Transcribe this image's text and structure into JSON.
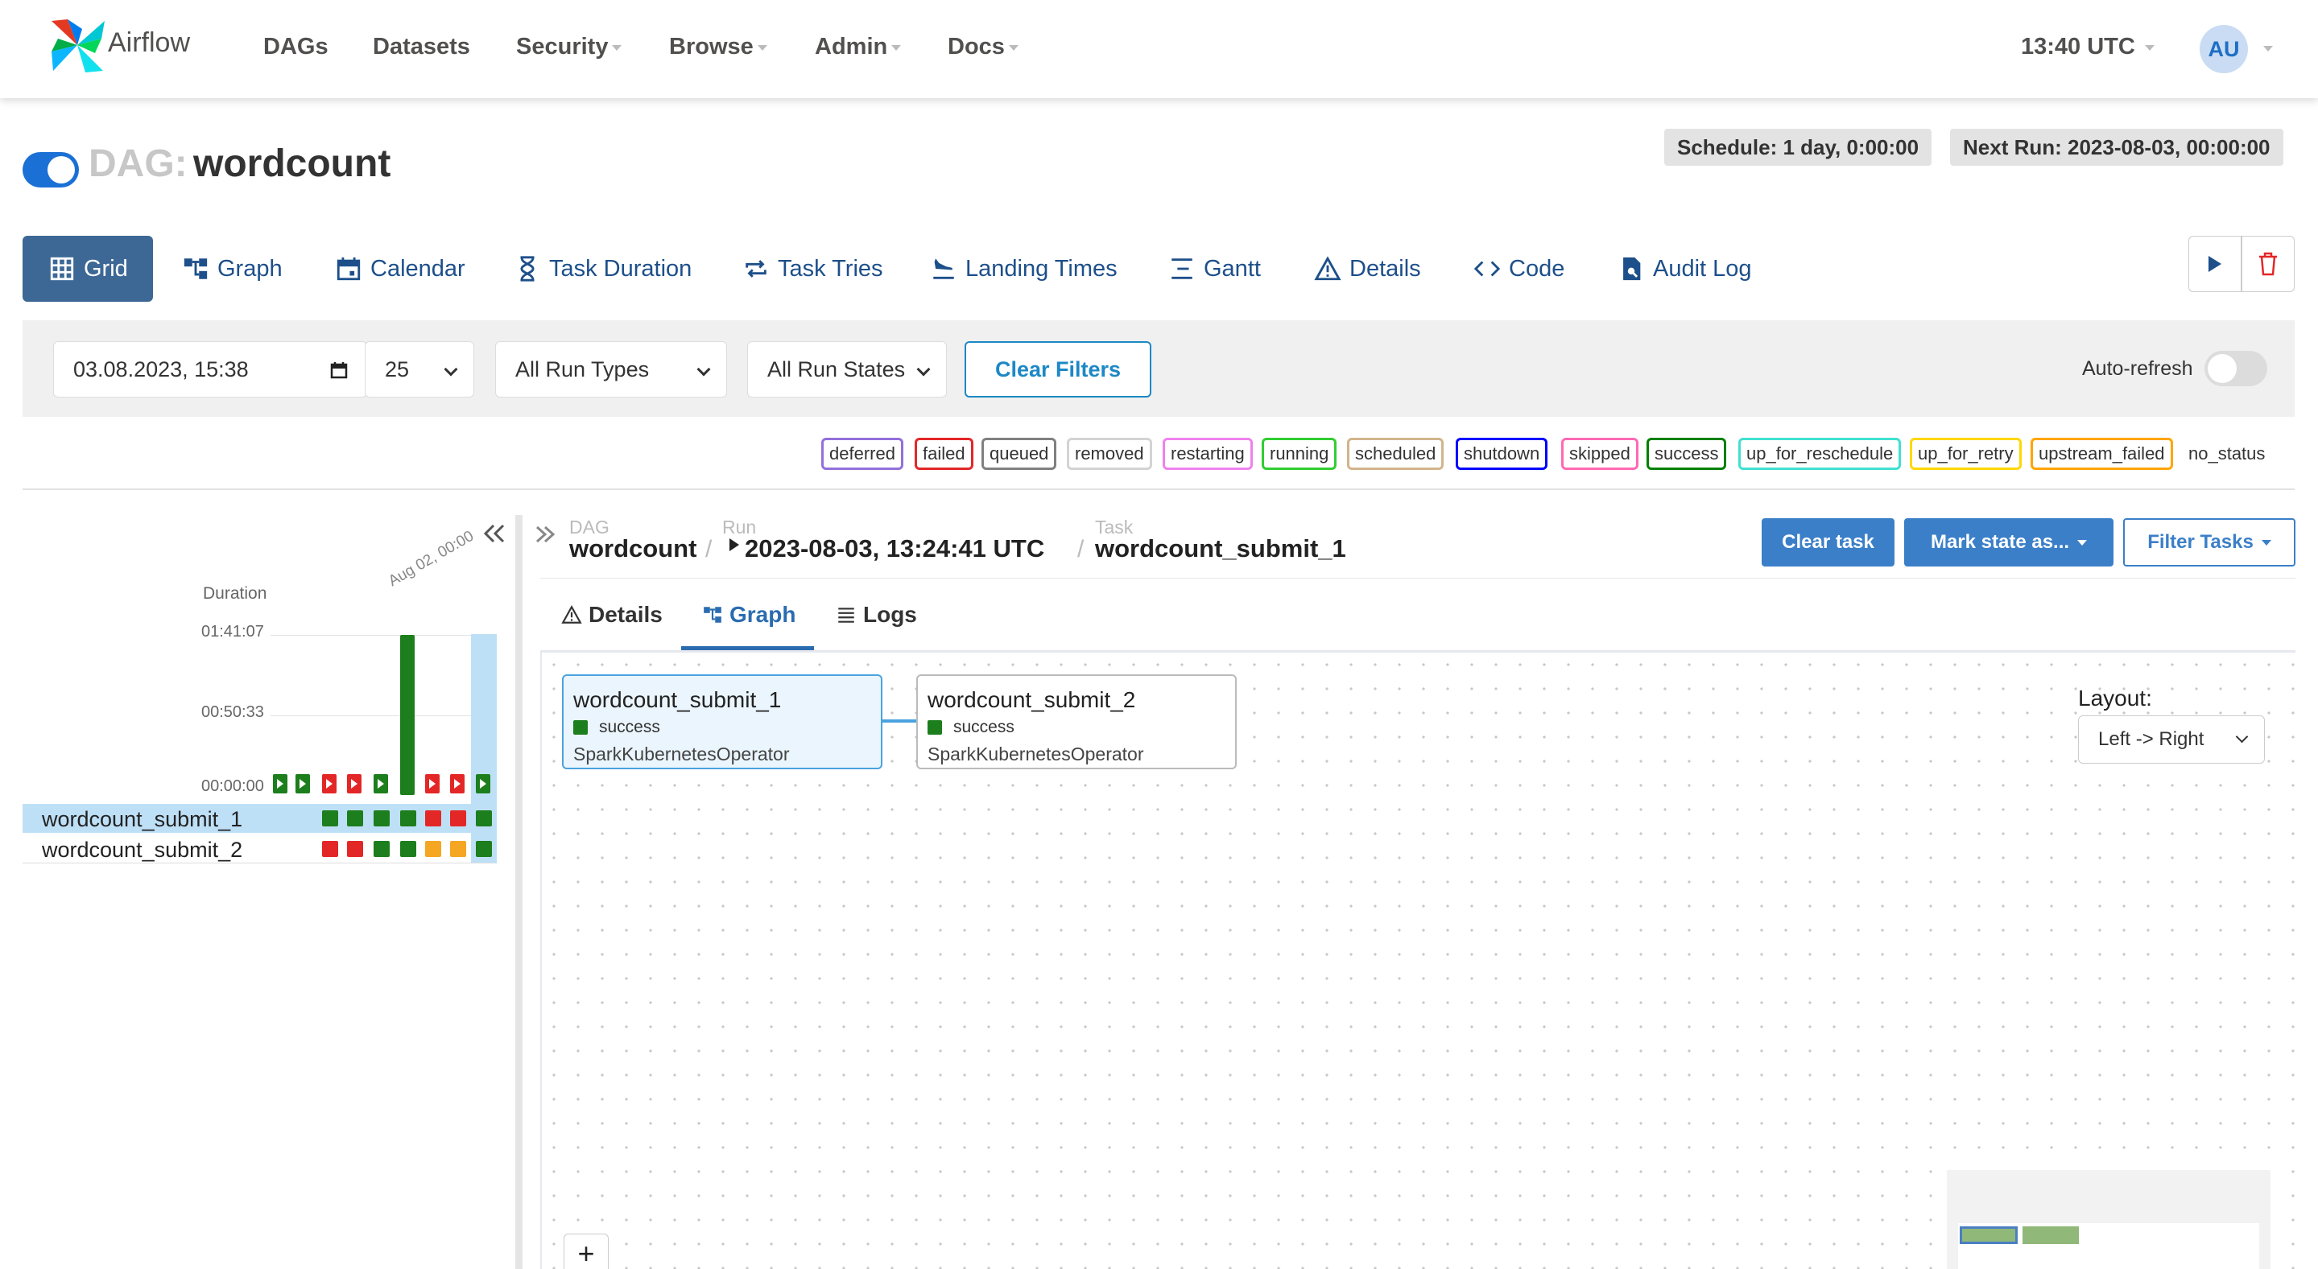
{
  "navbar": {
    "brand": "Airflow",
    "items": [
      {
        "label": "DAGs"
      },
      {
        "label": "Datasets"
      },
      {
        "label": "Security"
      },
      {
        "label": "Browse"
      },
      {
        "label": "Admin"
      },
      {
        "label": "Docs"
      }
    ],
    "time": "13:40 UTC",
    "avatar": "AU"
  },
  "dag": {
    "prefix": "DAG:",
    "name": "wordcount",
    "schedule": "Schedule: 1 day, 0:00:00",
    "next_run": "Next Run: 2023-08-03, 00:00:00",
    "paused": false
  },
  "view_tabs": [
    {
      "label": "Grid",
      "icon": "grid-icon",
      "active": true
    },
    {
      "label": "Graph",
      "icon": "graph-icon"
    },
    {
      "label": "Calendar",
      "icon": "calendar-icon"
    },
    {
      "label": "Task Duration",
      "icon": "hourglass-icon"
    },
    {
      "label": "Task Tries",
      "icon": "repeat-icon"
    },
    {
      "label": "Landing Times",
      "icon": "plane-landing-icon"
    },
    {
      "label": "Gantt",
      "icon": "gantt-icon"
    },
    {
      "label": "Details",
      "icon": "warning-triangle-icon"
    },
    {
      "label": "Code",
      "icon": "code-icon"
    },
    {
      "label": "Audit Log",
      "icon": "file-search-icon"
    }
  ],
  "filters": {
    "date": "03.08.2023, 15:38",
    "num_runs": "25",
    "run_types": "All Run Types",
    "run_states": "All Run States",
    "clear_label": "Clear Filters",
    "auto_refresh_label": "Auto-refresh",
    "auto_refresh": false
  },
  "legend": [
    {
      "label": "deferred",
      "color": "#9370db"
    },
    {
      "label": "failed",
      "color": "#e32727"
    },
    {
      "label": "queued",
      "color": "#808080"
    },
    {
      "label": "removed",
      "color": "#d3d3d3"
    },
    {
      "label": "restarting",
      "color": "#ee82ee"
    },
    {
      "label": "running",
      "color": "#32cd32"
    },
    {
      "label": "scheduled",
      "color": "#d2b48c"
    },
    {
      "label": "shutdown",
      "color": "#0000ff"
    },
    {
      "label": "skipped",
      "color": "#ff69b4"
    },
    {
      "label": "success",
      "color": "#008000"
    },
    {
      "label": "up_for_reschedule",
      "color": "#40e0d0"
    },
    {
      "label": "up_for_retry",
      "color": "#ffd700"
    },
    {
      "label": "upstream_failed",
      "color": "#ffa500"
    },
    {
      "label": "no_status",
      "color": ""
    }
  ],
  "grid": {
    "duration_label": "Duration",
    "date_label": "Aug 02, 00:00",
    "ticks": [
      "01:41:07",
      "00:50:33",
      "00:00:00"
    ],
    "runs": [
      {
        "state": "success",
        "duration_fraction": 0.0
      },
      {
        "state": "success",
        "duration_fraction": 0.0
      },
      {
        "state": "failed",
        "duration_fraction": 0.0
      },
      {
        "state": "failed",
        "duration_fraction": 0.0
      },
      {
        "state": "success",
        "duration_fraction": 0.0
      },
      {
        "state": "success",
        "duration_fraction": 1.0
      },
      {
        "state": "failed",
        "duration_fraction": 0.0
      },
      {
        "state": "failed",
        "duration_fraction": 0.0
      },
      {
        "state": "success",
        "duration_fraction": 0.0
      }
    ],
    "tasks": [
      {
        "name": "wordcount_submit_1",
        "states": [
          "success",
          "success",
          "success",
          "success",
          "failed",
          "failed",
          "success"
        ]
      },
      {
        "name": "wordcount_submit_2",
        "states": [
          "failed",
          "failed",
          "success",
          "success",
          "upstream_failed",
          "upstream_failed",
          "success"
        ]
      }
    ]
  },
  "details": {
    "breadcrumb": {
      "dag_label": "DAG",
      "dag_value": "wordcount",
      "run_label": "Run",
      "run_value": "2023-08-03, 13:24:41 UTC",
      "task_label": "Task",
      "task_value": "wordcount_submit_1",
      "separator": "/"
    },
    "actions": {
      "clear_task": "Clear task",
      "mark_state": "Mark state as...",
      "filter_tasks": "Filter Tasks"
    },
    "tabs": [
      {
        "label": "Details",
        "icon": "warning-triangle-icon"
      },
      {
        "label": "Graph",
        "icon": "graph-icon",
        "active": true
      },
      {
        "label": "Logs",
        "icon": "list-icon"
      }
    ]
  },
  "graph": {
    "nodes": [
      {
        "title": "wordcount_submit_1",
        "state": "success",
        "operator": "SparkKubernetesOperator",
        "selected": true
      },
      {
        "title": "wordcount_submit_2",
        "state": "success",
        "operator": "SparkKubernetesOperator",
        "selected": false
      }
    ],
    "layout_label": "Layout:",
    "layout_value": "Left -> Right",
    "zoom_in": "+"
  },
  "colors": {
    "success": "#1c7e1c",
    "failed": "#e32727",
    "upstream_failed": "#f5a623",
    "accent": "#3d6896",
    "primary_button": "#3b7fc8"
  }
}
